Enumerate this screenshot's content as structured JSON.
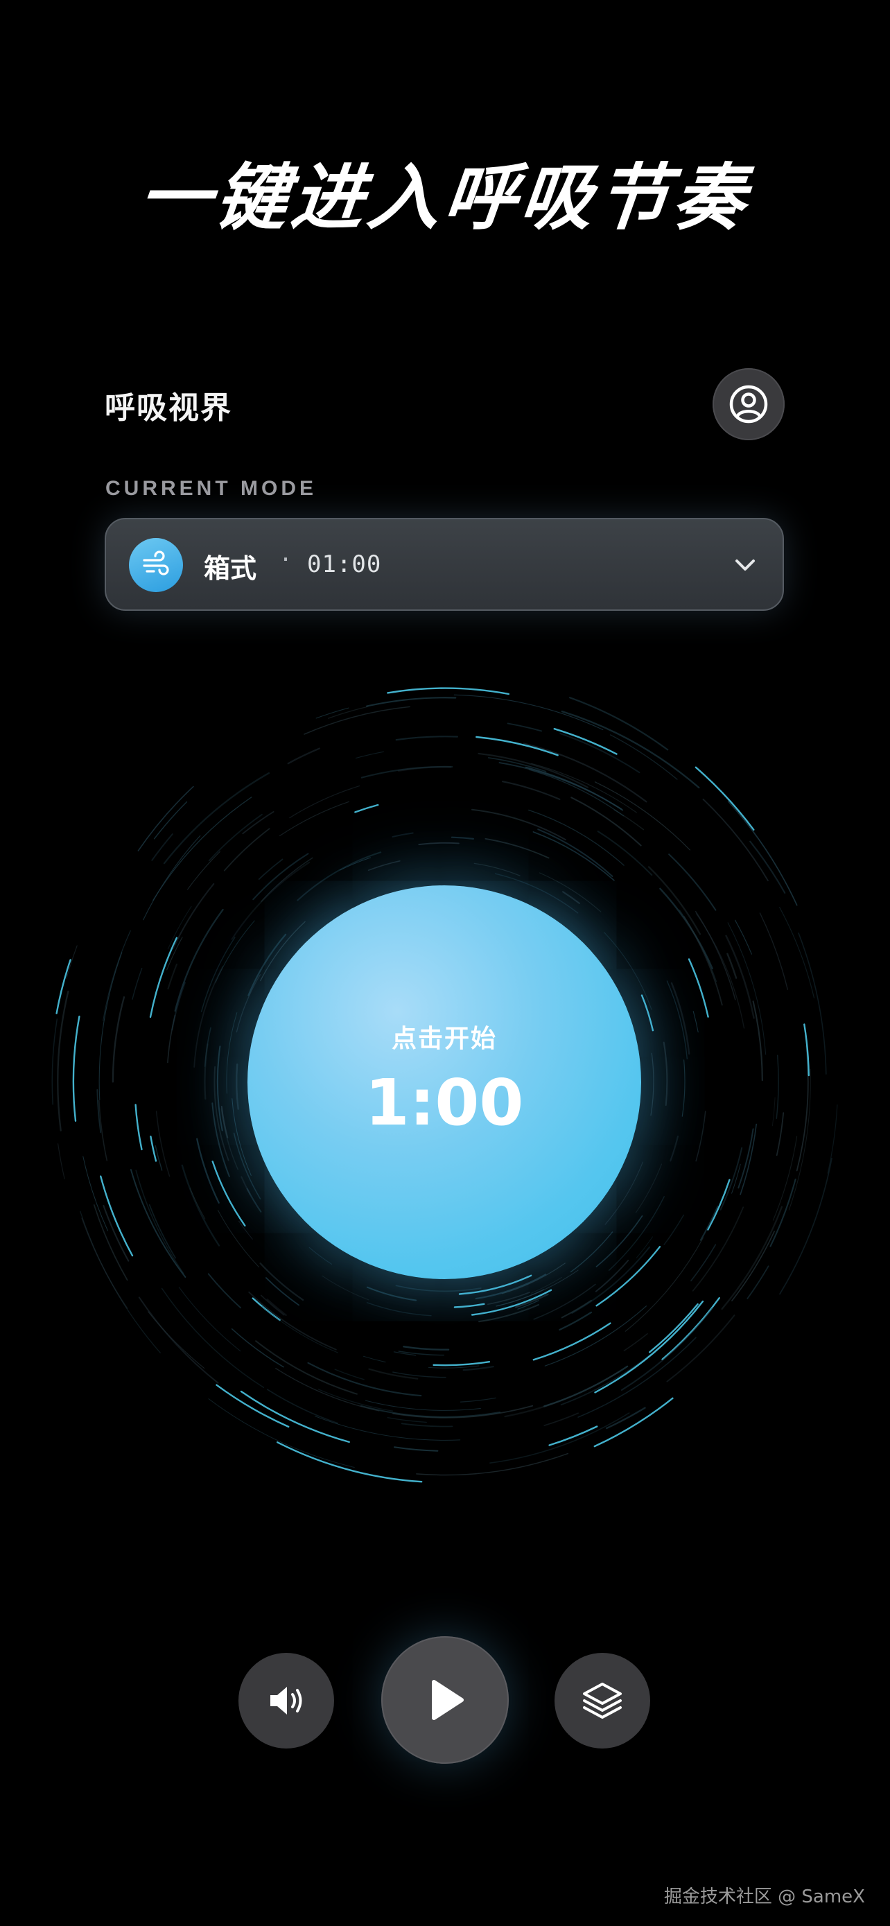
{
  "hero": {
    "title": "一键进入呼吸节奏"
  },
  "header": {
    "app_title": "呼吸视界",
    "profile_icon": "user-circle-icon"
  },
  "mode": {
    "label": "CURRENT MODE",
    "name": "箱式",
    "separator": "·",
    "duration": "01:00",
    "icon": "wind-icon"
  },
  "breath": {
    "hint": "点击开始",
    "time": "1:00"
  },
  "controls": {
    "sound_icon": "speaker-icon",
    "play_icon": "play-icon",
    "layers_icon": "layers-icon"
  },
  "watermark": "掘金技术社区 @ SameX",
  "colors": {
    "background": "#000000",
    "accent": "#4fc3ee",
    "control_bg": "#3a3a3d"
  }
}
